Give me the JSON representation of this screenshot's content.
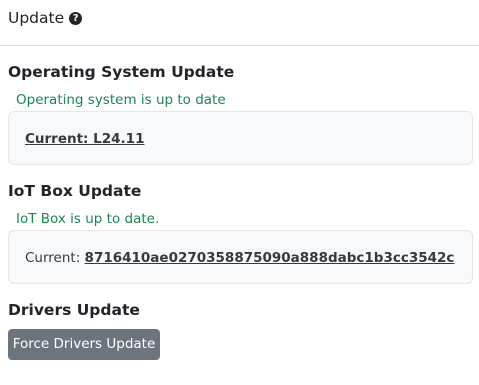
{
  "header": {
    "title": "Update",
    "help_icon": "question-circle-icon"
  },
  "os_update": {
    "title": "Operating System Update",
    "status": "Operating system is up to date",
    "current_label": "Current: L24.11"
  },
  "iot_update": {
    "title": "IoT Box Update",
    "status": "IoT Box is up to date.",
    "current_prefix": "Current: ",
    "current_value": "8716410ae0270358875090a888dabc1b3cc3542c"
  },
  "drivers_update": {
    "title": "Drivers Update",
    "button_label": "Force Drivers Update"
  },
  "colors": {
    "success": "#198754",
    "button_secondary": "#6c757d"
  }
}
